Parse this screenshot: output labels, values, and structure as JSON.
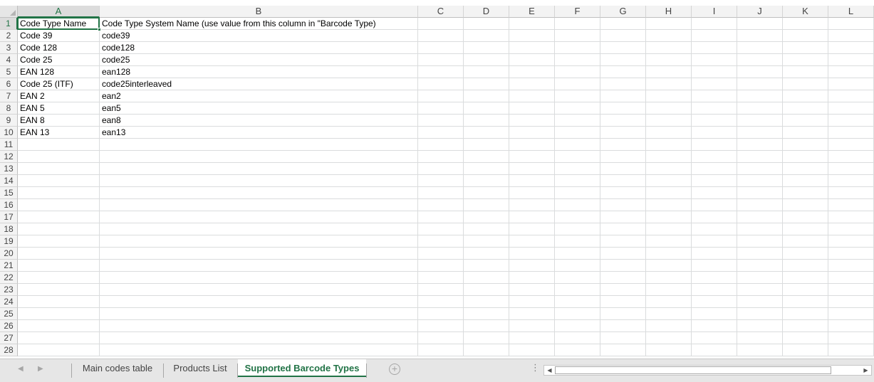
{
  "columns": [
    "A",
    "B",
    "C",
    "D",
    "E",
    "F",
    "G",
    "H",
    "I",
    "J",
    "K",
    "L"
  ],
  "rows": [
    "1",
    "2",
    "3",
    "4",
    "5",
    "6",
    "7",
    "8",
    "9",
    "10",
    "11",
    "12",
    "13",
    "14",
    "15",
    "16",
    "17",
    "18",
    "19",
    "20",
    "21",
    "22",
    "23",
    "24",
    "25",
    "26",
    "27",
    "28"
  ],
  "active_cell": "A1",
  "cells": [
    [
      "Code Type Name",
      "Code Type System Name (use value from this column in \"Barcode Type)"
    ],
    [
      "Code 39",
      "code39"
    ],
    [
      "Code 128",
      "code128"
    ],
    [
      "Code 25",
      "code25"
    ],
    [
      "EAN 128",
      "ean128"
    ],
    [
      "Code 25 (ITF)",
      "code25interleaved"
    ],
    [
      "EAN 2",
      "ean2"
    ],
    [
      "EAN 5",
      "ean5"
    ],
    [
      "EAN 8",
      "ean8"
    ],
    [
      "EAN 13",
      "ean13"
    ]
  ],
  "sheet_tabs": [
    {
      "label": "Main codes table",
      "active": false
    },
    {
      "label": "Products List",
      "active": false
    },
    {
      "label": "Supported Barcode Types",
      "active": true
    }
  ],
  "icons": {
    "corner": "select-all-triangle-icon",
    "prev_sheet": "chevron-left-icon",
    "next_sheet": "chevron-right-icon",
    "add_sheet": "plus-circle-icon",
    "split": "vertical-dots-icon",
    "scroll_left": "arrow-left-icon",
    "scroll_right": "arrow-right-icon"
  },
  "colors": {
    "accent": "#217346",
    "header_bg": "#f3f3f3",
    "gridline": "#dadcdd"
  }
}
